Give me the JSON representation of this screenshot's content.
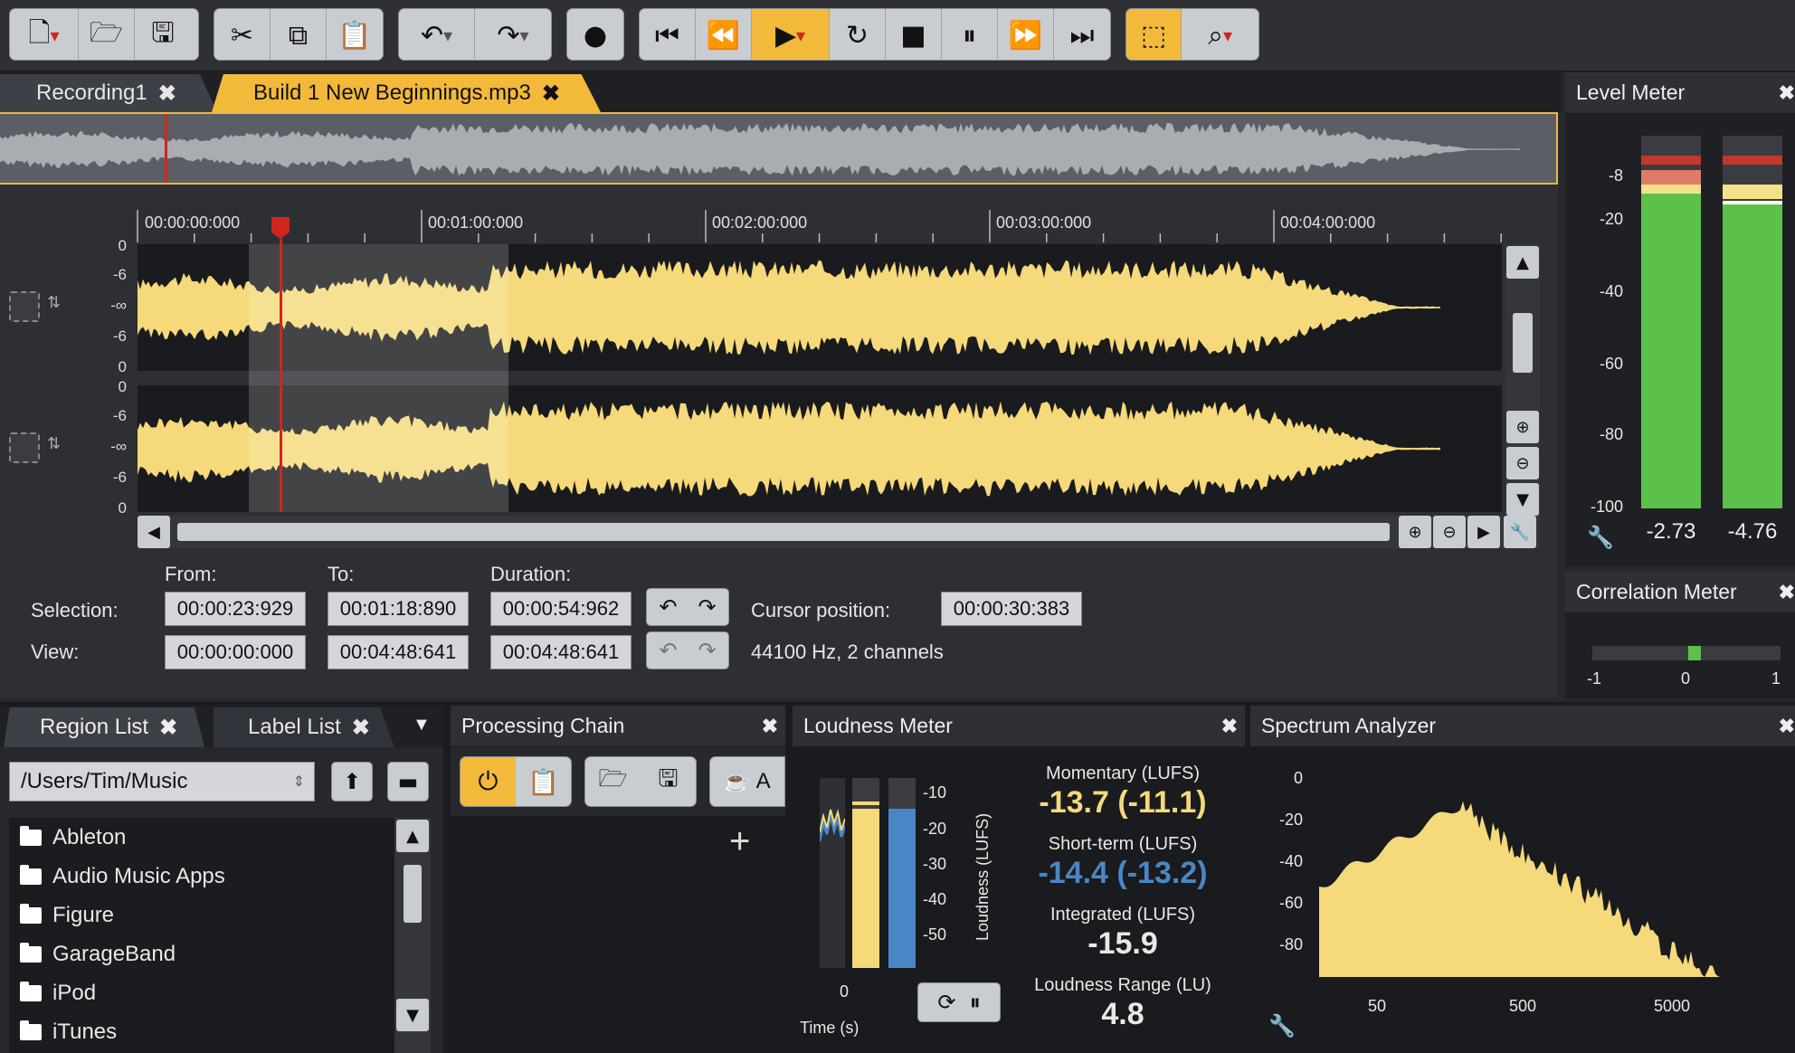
{
  "toolbar": {
    "groups": [
      {
        "name": "file",
        "icons": [
          "new-file-icon",
          "open-folder-icon",
          "save-icon"
        ]
      },
      {
        "name": "edit",
        "icons": [
          "cut-icon",
          "copy-icon",
          "paste-icon"
        ]
      },
      {
        "name": "history",
        "icons": [
          "undo-icon",
          "redo-icon"
        ]
      },
      {
        "name": "record",
        "icons": [
          "record-icon"
        ]
      },
      {
        "name": "transport",
        "icons": [
          "skip-start-icon",
          "rewind-icon",
          "play-icon",
          "loop-icon",
          "stop-icon",
          "pause-icon",
          "fast-forward-icon",
          "skip-end-icon"
        ]
      },
      {
        "name": "tools",
        "icons": [
          "select-tool-icon",
          "zoom-tool-icon"
        ]
      }
    ]
  },
  "tabs": [
    {
      "label": "Recording1",
      "active": false
    },
    {
      "label": "Build 1 New Beginnings.mp3",
      "active": true
    }
  ],
  "ruler": {
    "labels": [
      "00:00:00:000",
      "00:01:00:000",
      "00:02:00:000",
      "00:03:00:000",
      "00:04:00:000"
    ]
  },
  "track": {
    "ylabels": [
      "0",
      "-6",
      "-∞",
      "-6",
      "0"
    ]
  },
  "selection": {
    "from_label": "From:",
    "to_label": "To:",
    "duration_label": "Duration:",
    "selection_label": "Selection:",
    "view_label": "View:",
    "sel_from": "00:00:23:929",
    "sel_to": "00:01:18:890",
    "sel_duration": "00:00:54:962",
    "view_from": "00:00:00:000",
    "view_to": "00:04:48:641",
    "view_duration": "00:04:48:641",
    "cursor_label": "Cursor position:",
    "cursor_value": "00:00:30:383",
    "format": "44100 Hz, 2 channels"
  },
  "level_meter": {
    "title": "Level Meter",
    "scale": [
      "-8",
      "-20",
      "-40",
      "-60",
      "-80",
      "-100"
    ],
    "left_value": "-2.73",
    "right_value": "-4.76"
  },
  "correlation_meter": {
    "title": "Correlation Meter",
    "scale": [
      "-1",
      "0",
      "1"
    ]
  },
  "region_list": {
    "tab1": "Region List",
    "tab2": "Label List",
    "path": "/Users/Tim/Music",
    "folders": [
      "Ableton",
      "Audio Music Apps",
      "Figure",
      "GarageBand",
      "iPod",
      "iTunes"
    ]
  },
  "processing_chain": {
    "title": "Processing Chain",
    "add": "+",
    "truncated": "A"
  },
  "loudness": {
    "title": "Loudness Meter",
    "scale": [
      "-10",
      "-20",
      "-30",
      "-40",
      "-50"
    ],
    "axis_label": "Loudness (LUFS)",
    "time_label": "Time (s)",
    "time_zero": "0",
    "momentary_label": "Momentary (LUFS)",
    "momentary_value": "-13.7 (-11.1)",
    "shortterm_label": "Short-term (LUFS)",
    "shortterm_value": "-14.4 (-13.2)",
    "integrated_label": "Integrated (LUFS)",
    "integrated_value": "-15.9",
    "range_label": "Loudness Range (LU)",
    "range_value": "4.8"
  },
  "spectrum": {
    "title": "Spectrum Analyzer",
    "yscale": [
      "0",
      "-20",
      "-40",
      "-60",
      "-80"
    ],
    "xscale": [
      "50",
      "500",
      "5000"
    ]
  },
  "colors": {
    "accent": "#f2b93a",
    "wave": "#f5d97a",
    "green": "#5cc14a",
    "blue": "#4a86c5",
    "playhead": "#d0251f"
  }
}
